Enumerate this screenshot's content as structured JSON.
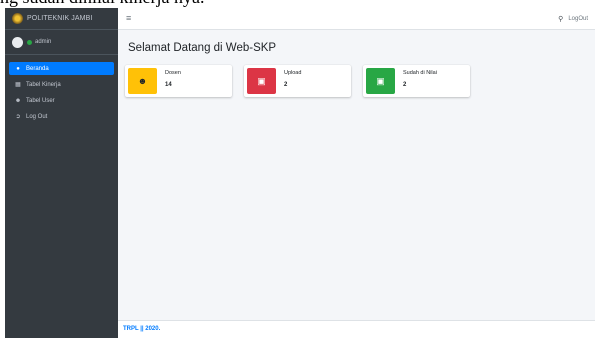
{
  "top_text": "ng sudah dinilai kinerja nya.",
  "brand": {
    "name": "POLITEKNIK JAMBI"
  },
  "user": {
    "name": "admin"
  },
  "nav": [
    {
      "label": "Beranda",
      "icon": "dashboard-icon",
      "active": true
    },
    {
      "label": "Tabel Kinerja",
      "icon": "table-icon",
      "active": false
    },
    {
      "label": "Tabel User",
      "icon": "users-icon",
      "active": false
    },
    {
      "label": "Log Out",
      "icon": "sign-out-icon",
      "active": false
    }
  ],
  "header": {
    "menu_icon": "bars-icon",
    "search_icon": "search-icon",
    "logout_label": "LogOut"
  },
  "page": {
    "title": "Selamat Datang di Web-SKP"
  },
  "boxes": [
    {
      "label": "Dosen",
      "value": "14",
      "icon": "users-icon",
      "color": "#ffc107"
    },
    {
      "label": "Upload",
      "value": "2",
      "icon": "file-icon",
      "color": "#dc3545"
    },
    {
      "label": "Sudah di Nilai",
      "value": "2",
      "icon": "file-icon",
      "color": "#28a745"
    }
  ],
  "footer": {
    "text": "TRPL || 2020."
  }
}
